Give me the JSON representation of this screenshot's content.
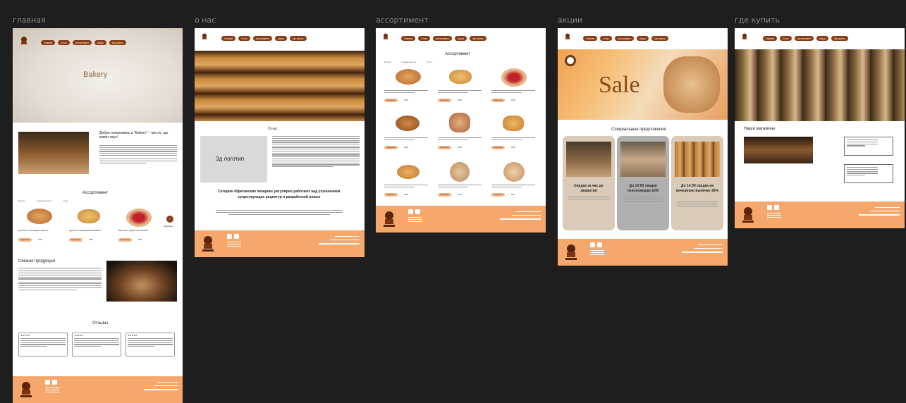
{
  "frames": {
    "home": "главная",
    "about": "о нас",
    "assortment": "ассортимент",
    "sales": "акции",
    "where": "где купить"
  },
  "nav": [
    "Главная",
    "О нас",
    "Ассортимент",
    "Акции",
    "Где купить"
  ],
  "home": {
    "hero_title": "Bakery",
    "welcome_title": "Добро пожаловать в \"Bakery\" – место, где живёт вкус!",
    "assortment_title": "Ассортимент",
    "tabs": [
      "Булочки",
      "Сладкая выпечка",
      "Торты"
    ],
    "products": [
      {
        "name": "Круассан с шоколадом и ванилью",
        "btn": "Подробнее",
        "price": "150₽"
      },
      {
        "name": "Круассан с марципановой начинкой",
        "btn": "Подробнее",
        "price": "150₽"
      },
      {
        "name": "Ватрушка с брусничной начинкой",
        "btn": "Подробнее",
        "price": "150₽"
      }
    ],
    "more_label": "Подробнее",
    "fresh_title": "Свежая продукция",
    "reviews_title": "Отзывы",
    "stars": "★★★★★"
  },
  "about": {
    "title": "О нас",
    "logo_placeholder": "3д логотип",
    "headline": "Сегодня «Британские пекарни» регулярно работают над улучшением существующих рецептур и разработкой новых"
  },
  "assortment": {
    "title": "Ассортимент",
    "tabs": [
      "Булочки",
      "Сладкая выпечка",
      "Торты"
    ],
    "btn": "Подробнее",
    "price": "150₽"
  },
  "sales": {
    "hero": "Sale",
    "title": "Специальные предложения",
    "offers": [
      "Скидка за час до закрытия",
      "До 13:00 скидка пенсионерам 10%",
      "До 14:00 скидка на вечернюю выпечку 30%"
    ]
  },
  "where": {
    "title": "Наши магазины"
  },
  "colors": {
    "accent": "#8a3c14",
    "footer": "#f6a86c",
    "canvas": "#1e1e1e"
  }
}
